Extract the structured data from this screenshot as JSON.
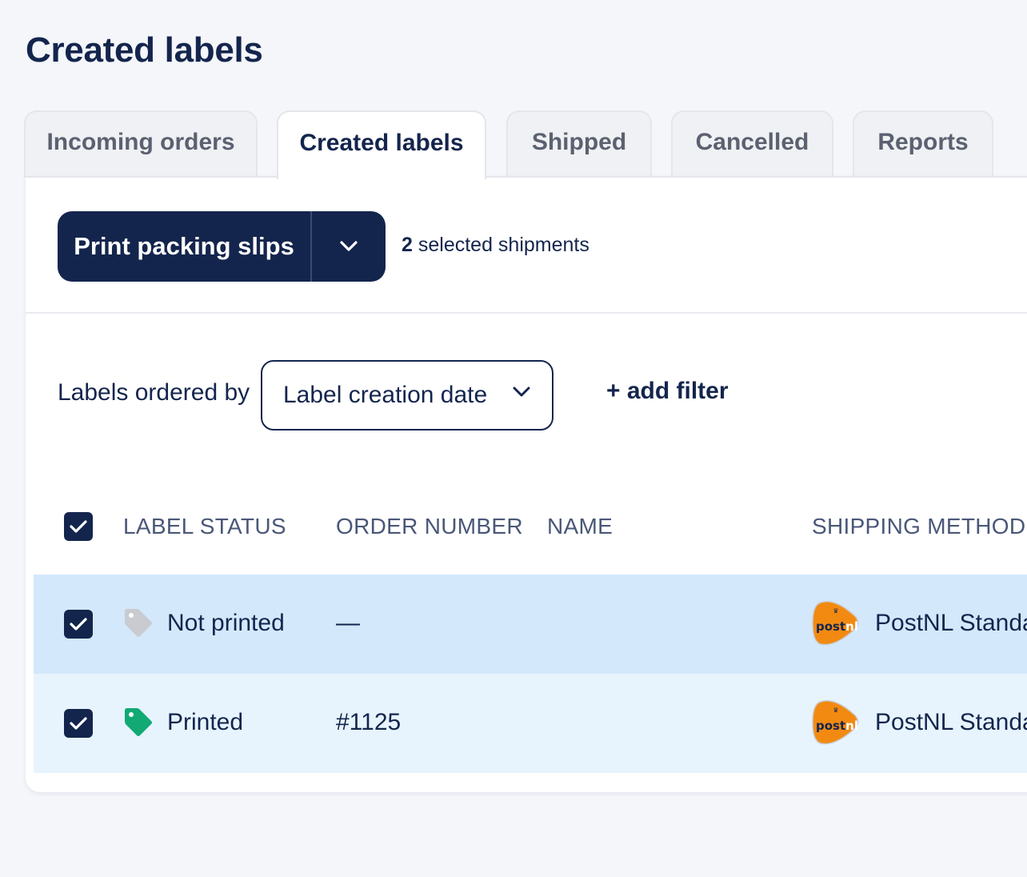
{
  "page_title": "Created labels",
  "tabs": [
    {
      "label": "Incoming orders",
      "active": false
    },
    {
      "label": "Created labels",
      "active": true
    },
    {
      "label": "Shipped",
      "active": false
    },
    {
      "label": "Cancelled",
      "active": false
    },
    {
      "label": "Reports",
      "active": false
    }
  ],
  "toolbar": {
    "print_button_label": "Print packing slips",
    "dropdown_icon": "chevron-down-icon",
    "selected_count": "2",
    "selected_text": "selected shipments"
  },
  "filters": {
    "order_label": "Labels ordered by",
    "order_value": "Label creation date",
    "add_filter_label": "+ add filter"
  },
  "table": {
    "headers": [
      "LABEL STATUS",
      "ORDER NUMBER",
      "NAME",
      "SHIPPING METHOD"
    ],
    "select_all_checked": true,
    "rows": [
      {
        "checked": true,
        "status": "Not printed",
        "status_icon": "tag-icon",
        "status_color": "#c9cbd0",
        "order_number": "—",
        "name": "",
        "shipping_method": "PostNL Standa",
        "carrier_logo": "postnl"
      },
      {
        "checked": true,
        "status": "Printed",
        "status_icon": "tag-icon",
        "status_color": "#12a974",
        "order_number": "#1125",
        "name": "",
        "shipping_method": "PostNL Standa",
        "carrier_logo": "postnl"
      }
    ]
  },
  "colors": {
    "primary": "#14254d",
    "row_selected": "#d3e8fb",
    "row_alt": "#e7f4fd",
    "printed_tag": "#12a974",
    "not_printed_tag": "#c9cbd0",
    "postnl_orange": "#f28a12"
  },
  "carrier_logo_text": {
    "post": "post",
    "nl": "nl"
  }
}
